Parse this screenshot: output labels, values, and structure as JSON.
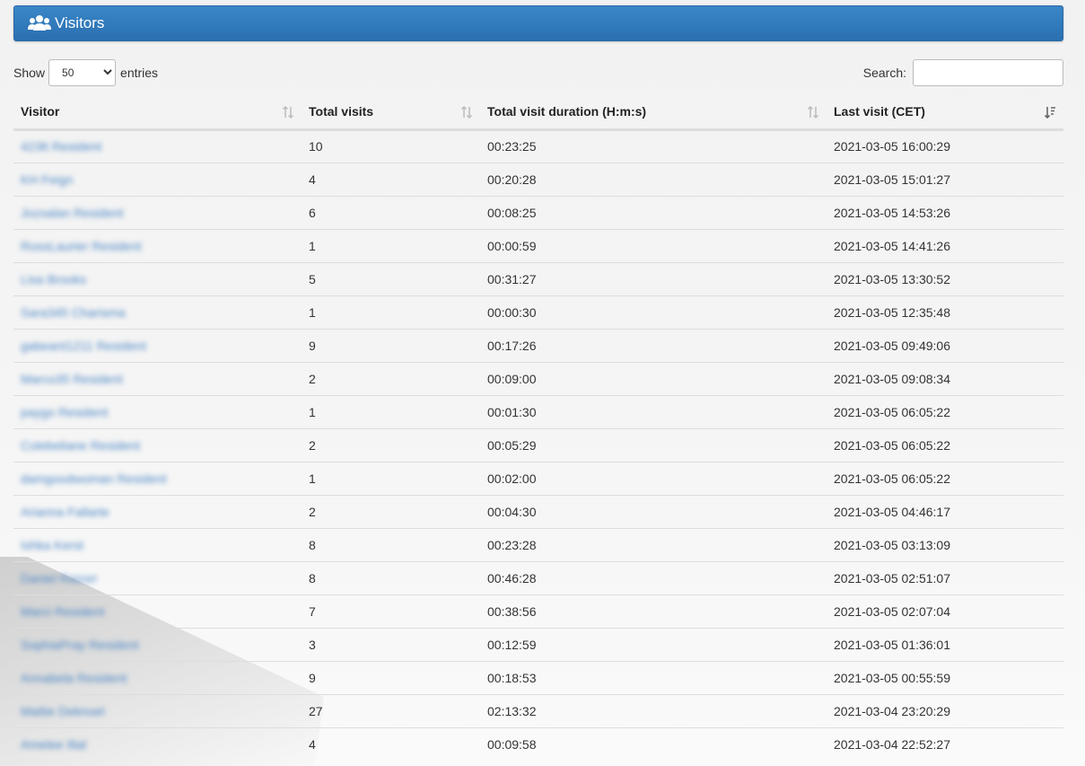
{
  "header": {
    "title": "Visitors",
    "icon": "users-icon"
  },
  "controls": {
    "show_label": "Show",
    "entries_label": "entries",
    "page_length": "50",
    "search_label": "Search:",
    "search_value": ""
  },
  "table": {
    "columns": [
      "Visitor",
      "Total visits",
      "Total visit duration (H:m:s)",
      "Last visit (CET)"
    ],
    "rows": [
      {
        "visitor": "4236 Resident",
        "visits": "10",
        "duration": "00:23:25",
        "last": "2021-03-05 16:00:29"
      },
      {
        "visitor": "KH Feign",
        "visits": "4",
        "duration": "00:20:28",
        "last": "2021-03-05 15:01:27"
      },
      {
        "visitor": "Jozsalan Resident",
        "visits": "6",
        "duration": "00:08:25",
        "last": "2021-03-05 14:53:26"
      },
      {
        "visitor": "RossLaurier Resident",
        "visits": "1",
        "duration": "00:00:59",
        "last": "2021-03-05 14:41:26"
      },
      {
        "visitor": "Lisa Brooks",
        "visits": "5",
        "duration": "00:31:27",
        "last": "2021-03-05 13:30:52"
      },
      {
        "visitor": "Sara345 Charisma",
        "visits": "1",
        "duration": "00:00:30",
        "last": "2021-03-05 12:35:48"
      },
      {
        "visitor": "gabeant1211 Resident",
        "visits": "9",
        "duration": "00:17:26",
        "last": "2021-03-05 09:49:06"
      },
      {
        "visitor": "Marco35 Resident",
        "visits": "2",
        "duration": "00:09:00",
        "last": "2021-03-05 09:08:34"
      },
      {
        "visitor": "paygo Resident",
        "visits": "1",
        "duration": "00:01:30",
        "last": "2021-03-05 06:05:22"
      },
      {
        "visitor": "Colebeliane Resident",
        "visits": "2",
        "duration": "00:05:29",
        "last": "2021-03-05 06:05:22"
      },
      {
        "visitor": "damgoodwoman Resident",
        "visits": "1",
        "duration": "00:02:00",
        "last": "2021-03-05 06:05:22"
      },
      {
        "visitor": "Arianna Fallarte",
        "visits": "2",
        "duration": "00:04:30",
        "last": "2021-03-05 04:46:17"
      },
      {
        "visitor": "Ishka Kerst",
        "visits": "8",
        "duration": "00:23:28",
        "last": "2021-03-05 03:13:09"
      },
      {
        "visitor": "Daniel Razorr",
        "visits": "8",
        "duration": "00:46:28",
        "last": "2021-03-05 02:51:07"
      },
      {
        "visitor": "Marci Resident",
        "visits": "7",
        "duration": "00:38:56",
        "last": "2021-03-05 02:07:04"
      },
      {
        "visitor": "SophiaPray Resident",
        "visits": "3",
        "duration": "00:12:59",
        "last": "2021-03-05 01:36:01"
      },
      {
        "visitor": "Annabela Resident",
        "visits": "9",
        "duration": "00:18:53",
        "last": "2021-03-05 00:55:59"
      },
      {
        "visitor": "Mattie Deknoel",
        "visits": "27",
        "duration": "02:13:32",
        "last": "2021-03-04 23:20:29"
      },
      {
        "visitor": "Amelee Iltal",
        "visits": "4",
        "duration": "00:09:58",
        "last": "2021-03-04 22:52:27"
      }
    ]
  },
  "colors": {
    "header_bg": "#2f79bd",
    "link": "#4a86c5"
  }
}
